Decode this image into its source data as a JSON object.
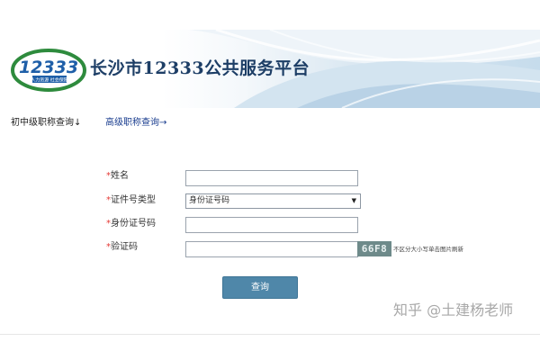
{
  "header": {
    "site_title": "长沙市12333公共服务平台",
    "logo_number": "12333",
    "logo_caption": "人力资源 社会保障"
  },
  "tabs": [
    {
      "label": "初中级职称查询↓"
    },
    {
      "label": "高级职称查询→"
    }
  ],
  "form": {
    "required_mark": "*",
    "fields": [
      {
        "label": "姓名",
        "value": ""
      },
      {
        "label": "证件号类型",
        "value": "身份证号码"
      },
      {
        "label": "身份证号码",
        "value": ""
      },
      {
        "label": "验证码",
        "value": ""
      }
    ],
    "captcha_text": "66F8",
    "captcha_hint": "不区分大小写单击图片刷新",
    "submit_label": "查询"
  },
  "watermark": "知乎 @土建杨老师",
  "colors": {
    "title": "#1d3e66",
    "button": "#4f87a9",
    "required": "#e53935",
    "logo_green": "#2e8b3d",
    "logo_blue": "#1f5fa8"
  }
}
